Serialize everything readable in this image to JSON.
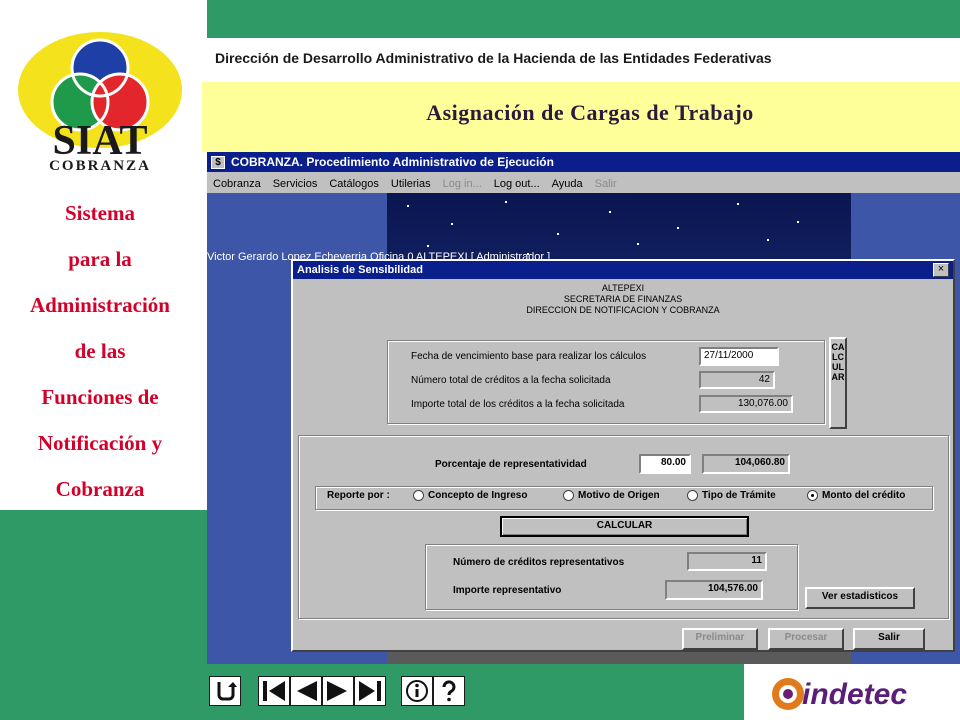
{
  "sidebar": {
    "logo_text": "SIAT",
    "logo_subtext": "COBRANZA",
    "title_lines": [
      "Sistema",
      "para la",
      "Administración",
      "de las",
      "Funciones de",
      "Notificación y",
      "Cobranza"
    ]
  },
  "header": {
    "subtitle": "Dirección de Desarrollo Administrativo de la Hacienda de las Entidades Federativas",
    "title": "Asignación de Cargas de Trabajo"
  },
  "app": {
    "icon": "$",
    "title": "COBRANZA. Procedimiento Administrativo de Ejecución",
    "menu": [
      {
        "label": "Cobranza",
        "disabled": false
      },
      {
        "label": "Servicios",
        "disabled": false
      },
      {
        "label": "Catálogos",
        "disabled": false
      },
      {
        "label": "Utilerias",
        "disabled": false
      },
      {
        "label": "Log in...",
        "disabled": true
      },
      {
        "label": "Log out...",
        "disabled": false
      },
      {
        "label": "Ayuda",
        "disabled": false
      },
      {
        "label": "Salir",
        "disabled": true
      }
    ],
    "user_status": "Victor Gerardo Lopez Echeverria Oficina 0  ALTEPEXI [ Administrador ]"
  },
  "dialog": {
    "title": "Analisis de Sensibilidad",
    "close_label": "×",
    "org": [
      "ALTEPEXI",
      "SECRETARIA DE FINANZAS",
      "DIRECCION DE NOTIFICACION Y COBRANZA"
    ],
    "fecha_label": "Fecha de vencimiento base para realizar los cálculos",
    "fecha_value": "27/11/2000",
    "num_label": "Número total de créditos a la fecha solicitada",
    "num_value": "42",
    "importe_label": "Importe total de los créditos a la fecha solicitada",
    "importe_value": "130,076.00",
    "calcular_vertical": "CALCULAR",
    "porcentaje_label": "Porcentaje de representatividad",
    "porcentaje_value": "80.00",
    "porcentaje_amount": "104,060.80",
    "reporte_label": "Reporte por :",
    "reporte_options": [
      {
        "label": "Concepto de Ingreso",
        "selected": false
      },
      {
        "label": "Motivo de Origen",
        "selected": false
      },
      {
        "label": "Tipo de Trámite",
        "selected": false
      },
      {
        "label": "Monto del crédito",
        "selected": true
      }
    ],
    "calcular_button": "CALCULAR",
    "repr_num_label": "Número de créditos representativos",
    "repr_num_value": "11",
    "repr_importe_label": "Importe representativo",
    "repr_importe_value": "104,576.00",
    "ver_estadisticos": "Ver estadisticos",
    "preliminar": "Preliminar",
    "procesar": "Procesar",
    "salir": "Salir"
  },
  "footer": {
    "brand": "indetec",
    "nav_icons": [
      "return-icon",
      "first-icon",
      "previous-icon",
      "next-icon",
      "last-icon",
      "info-icon",
      "help-icon"
    ]
  },
  "colors": {
    "background_green": "#2f9a66",
    "title_red": "#d4002a",
    "window_blue": "#0a1f8c",
    "header_yellow": "#ffff99"
  }
}
